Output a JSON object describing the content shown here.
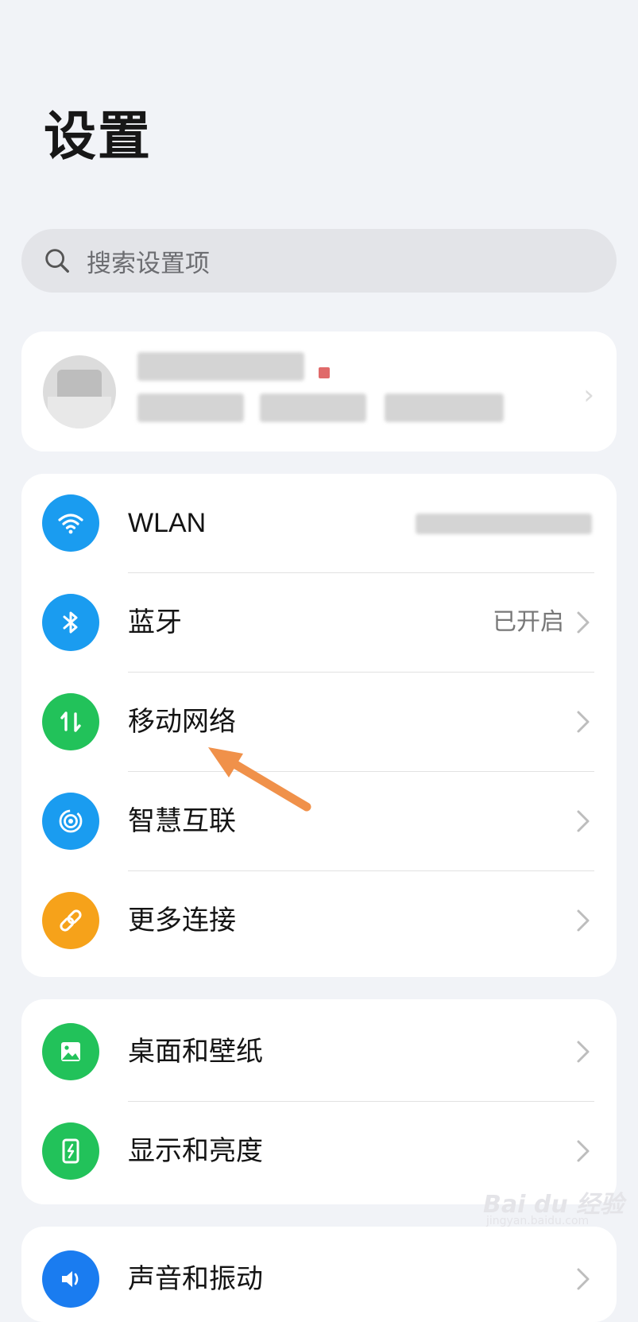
{
  "page": {
    "title": "设置"
  },
  "search": {
    "placeholder": "搜索设置项"
  },
  "connectivity": {
    "items": [
      {
        "label": "WLAN",
        "value": "",
        "icon": "wifi-icon",
        "color": "#1a9cf0"
      },
      {
        "label": "蓝牙",
        "value": "已开启",
        "icon": "bluetooth-icon",
        "color": "#1a9cf0"
      },
      {
        "label": "移动网络",
        "value": "",
        "icon": "mobile-data-icon",
        "color": "#22c25a"
      },
      {
        "label": "智慧互联",
        "value": "",
        "icon": "smart-connect-icon",
        "color": "#1a9cf0"
      },
      {
        "label": "更多连接",
        "value": "",
        "icon": "link-icon",
        "color": "#f6a21a"
      }
    ]
  },
  "personalization": {
    "items": [
      {
        "label": "桌面和壁纸",
        "icon": "wallpaper-icon",
        "color": "#22c25a"
      },
      {
        "label": "显示和亮度",
        "icon": "display-icon",
        "color": "#22c25a"
      }
    ]
  },
  "sound": {
    "items": [
      {
        "label": "声音和振动",
        "icon": "sound-icon",
        "color": "#1a7cf0"
      }
    ]
  },
  "watermark": {
    "brand": "Bai du 经验",
    "url": "jingyan.baidu.com"
  },
  "colors": {
    "background": "#f1f3f7",
    "annotation_arrow": "#f0914a"
  }
}
